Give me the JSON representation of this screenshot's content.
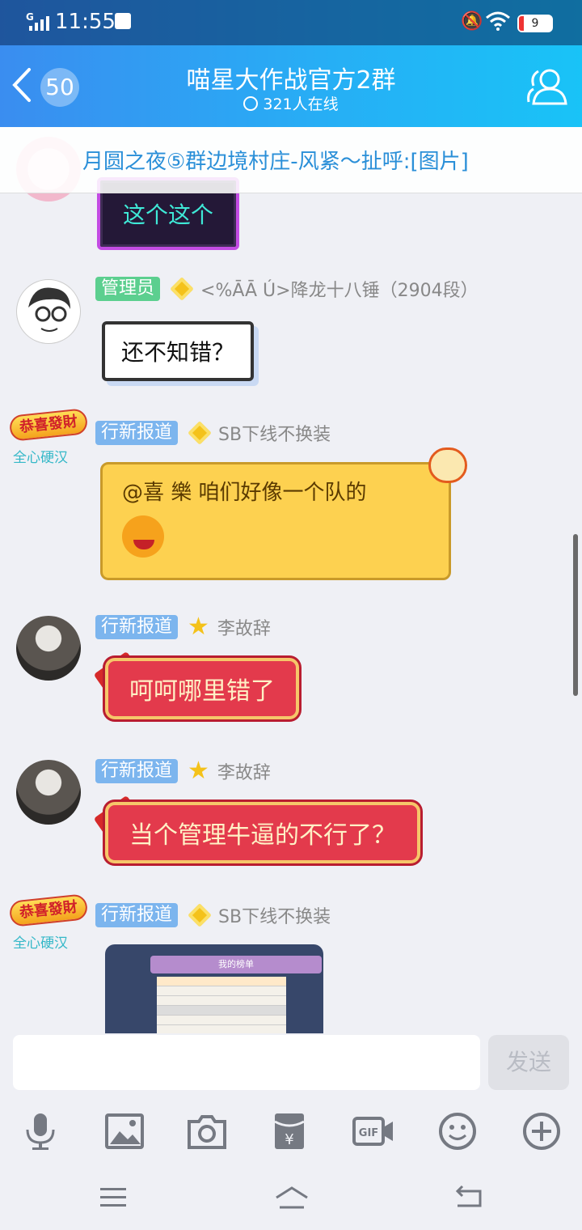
{
  "status": {
    "network": "G",
    "time": "11:55",
    "battery": "9"
  },
  "header": {
    "back_count": "50",
    "title": "喵星大作战官方2群",
    "online": "321人在线"
  },
  "notice": {
    "text": "月圆之夜⑤群边境村庄-风紧～扯呼:[图片]"
  },
  "messages": [
    {
      "bubble": "这个这个"
    },
    {
      "tag": "管理员",
      "nick": "<%ĀĀ Ú>降龙十八锤（2904段）",
      "bubble": "还不知错？"
    },
    {
      "lucky_top": "恭喜發財",
      "lucky_sub": "全心硬汉",
      "tag": "行新报道",
      "nick": "SB下线不换装",
      "bubble": "@喜  樂 咱们好像一个队的"
    },
    {
      "tag": "行新报道",
      "nick": "李故辞",
      "bubble": "呵呵哪里错了"
    },
    {
      "tag": "行新报道",
      "nick": "李故辞",
      "bubble": "当个管理牛逼的不行了？"
    },
    {
      "lucky_top": "恭喜發財",
      "lucky_sub": "全心硬汉",
      "tag": "行新报道",
      "nick": "SB下线不换装",
      "image_tabs": "我的榜单"
    }
  ],
  "input": {
    "placeholder": "",
    "send_label": "发送"
  },
  "toolbar": {
    "icons": [
      "microphone-icon",
      "image-icon",
      "camera-icon",
      "red-packet-icon",
      "gif-icon",
      "emoji-icon",
      "plus-icon"
    ]
  },
  "colors": {
    "header_start": "#3a8df0",
    "header_end": "#19c3f7",
    "notice_text": "#2a8fd8",
    "tag_admin": "#5ccf8f",
    "tag_new": "#7cb5ee"
  }
}
